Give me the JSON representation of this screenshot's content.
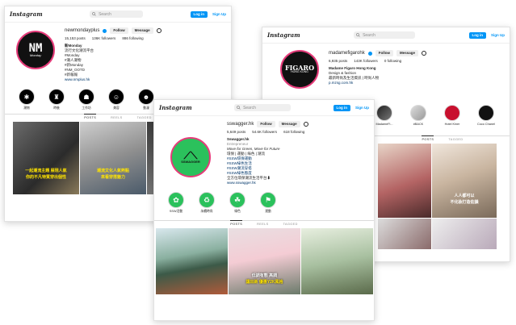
{
  "brand_logo": "Instagram",
  "search_placeholder": "Search",
  "login_label": "Log in",
  "signup_label": "Sign Up",
  "follow_label": "Follow",
  "message_label": "Message",
  "icons": {
    "search": "search-icon",
    "verified": "verified-badge-icon",
    "settings": "settings-icon",
    "grid": "grid-icon",
    "reels": "reels-icon",
    "tagged": "tagged-icon"
  },
  "colors": {
    "accent": "#0095f6",
    "green": "#2bc15c",
    "yellow_caption": "#ffe400",
    "figaro_red": "#c8102e"
  },
  "tabs": [
    "POSTS",
    "REELS",
    "TAGGED"
  ],
  "left": {
    "username": "newmondayplus",
    "posts": "15,153 posts",
    "followers": "136K followers",
    "following": "886 following",
    "bio": [
      "新Monday",
      "流行文化潮流平台",
      "#Monday",
      "#潮人潮物",
      "#新Monday",
      "#NM_OOTD",
      "#新報報"
    ],
    "link": "www.nmplus.hk",
    "avatar_text": "NM",
    "avatar_sub": "Monday",
    "highlights": [
      "潮物",
      "時裝",
      "工作坊",
      "美容",
      "動漫"
    ],
    "captions": [
      [
        "一起潮流主題 展現人氣",
        "你的不凡特質穿出個性"
      ],
      [
        "潮流文化人氣熱點",
        "來看穿搭魅力"
      ]
    ]
  },
  "right": {
    "username": "madamefigarohk",
    "posts": "6,935 posts",
    "followers": "143K followers",
    "following": "0 following",
    "bio": [
      "Madame Figaro Hong Kong",
      "Design & fashion",
      "最新時尚及生活資訊 | 時尚人物",
      "p.mzsg.com.hk"
    ],
    "avatar_text": "FIGARO",
    "avatar_sub": "HONG KONG",
    "highlights": [
      "MadameFi...",
      "#BACK",
      "Hotel Kiner",
      "Coco Chanel"
    ],
    "captions": [
      [
        "",
        ""
      ],
      [
        "人人都可以",
        "不化妝打造佐韻"
      ]
    ]
  },
  "center": {
    "username": "sswagger.hk",
    "posts": "5,649 posts",
    "followers": "54.6K followers",
    "following": "618 following",
    "bio": [
      "Sswagger.hk",
      "Entrepreneur",
      "Move for Green, Move for Future",
      "環保 | 運動 | 綠色 | 潮流",
      "#SSW環保運動",
      "#SSW綠色生活",
      "#SSW潮流穿搭",
      "#SSW綠色態度",
      "全方位環保潮流生活平台⬇",
      "www.sswagger.hk"
    ],
    "avatar_text": "SSWAGGER",
    "highlights": [
      "SSW活動",
      "永續時尚",
      "綠色",
      "運動"
    ],
    "captions": [
      [
        "",
        ""
      ],
      [
        "低調有態 高調",
        "讓出新 優惠Y2K風格"
      ],
      [
        "",
        ""
      ]
    ]
  }
}
